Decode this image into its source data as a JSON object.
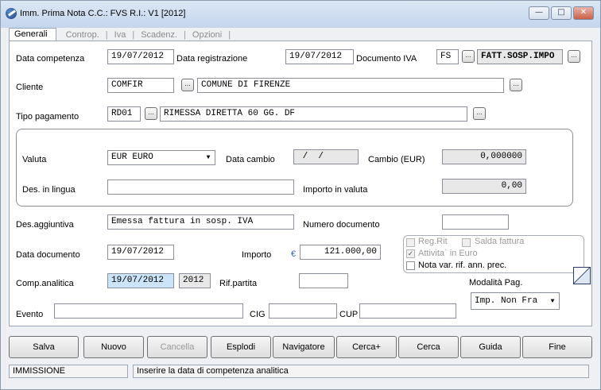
{
  "window": {
    "title": "Imm. Prima Nota C.C.: FVS  R.I.: V1  [2012]",
    "minimize": "—",
    "maximize": "□",
    "close": "✕"
  },
  "tabs": [
    {
      "label": "Generali",
      "active": true
    },
    {
      "label": "Controp."
    },
    {
      "label": "Iva"
    },
    {
      "label": "Scadenz."
    },
    {
      "label": "Opzioni"
    }
  ],
  "form": {
    "data_competenza_label": "Data competenza",
    "data_competenza": "19/07/2012",
    "data_registrazione_label": "Data registrazione",
    "data_registrazione": "19/07/2012",
    "documento_iva_label": "Documento IVA",
    "documento_iva_code": "FS",
    "documento_iva_desc": "FATT.SOSP.IMPO",
    "cliente_label": "Cliente",
    "cliente_code": "COMFIR",
    "cliente_desc": "COMUNE DI FIRENZE",
    "tipo_pagamento_label": "Tipo pagamento",
    "tipo_pagamento_code": "RD01",
    "tipo_pagamento_desc": "RIMESSA DIRETTA 60 GG. DF",
    "valuta_label": "Valuta",
    "valuta": "EUR EURO",
    "data_cambio_label": "Data cambio",
    "data_cambio": " /  /",
    "cambio_label": "Cambio  (EUR)",
    "cambio": "0,000000",
    "des_lingua_label": "Des. in lingua",
    "des_lingua": "",
    "importo_valuta_label": "Importo in valuta",
    "importo_valuta": "0,00",
    "des_aggiuntiva_label": "Des.aggiuntiva",
    "des_aggiuntiva": "Emessa fattura in sosp. IVA",
    "numero_documento_label": "Numero documento",
    "numero_documento": "",
    "data_documento_label": "Data documento",
    "data_documento": "19/07/2012",
    "importo_label": "Importo",
    "importo_symbol": "€",
    "importo": "121.000,00",
    "comp_analitica_label": "Comp.analitica",
    "comp_analitica": "19/07/2012",
    "comp_analitica_year": "2012",
    "rif_partita_label": "Rif.partita",
    "rif_partita": "",
    "modalita_pag_label": "Modalità Pag.",
    "modalita_pag": "Imp. Non Fra",
    "evento_label": "Evento",
    "evento": "",
    "cig_label": "CIG",
    "cig": "",
    "cup_label": "CUP",
    "cup": "",
    "dots_label": "..."
  },
  "checkboxes": {
    "reg_rit": "Reg.Rit",
    "saldo_fattura": "Salda fattura",
    "attivita_euro": "Attivita` in Euro",
    "nota_var": "Nota var. rif. ann. prec.",
    "check_mark": "✓"
  },
  "buttons": [
    {
      "label": "Salva"
    },
    {
      "label": "Nuovo"
    },
    {
      "label": "Cancella",
      "disabled": true
    },
    {
      "label": "Esplodi"
    },
    {
      "label": "Navigatore"
    },
    {
      "label": "Cerca+"
    },
    {
      "label": "Cerca"
    },
    {
      "label": "Guida"
    },
    {
      "label": "Fine"
    }
  ],
  "status": {
    "mode": "IMMISSIONE",
    "message": "Inserire la data di competenza analitica"
  }
}
